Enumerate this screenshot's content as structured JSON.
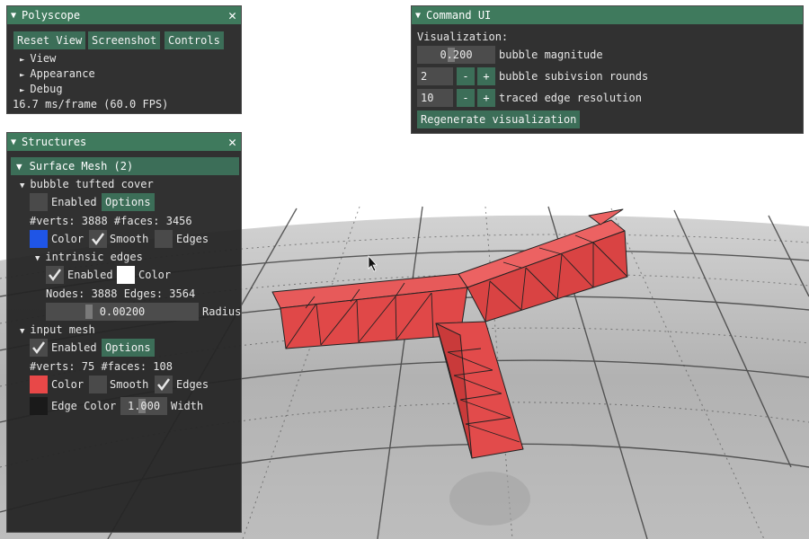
{
  "polyscope": {
    "title": "Polyscope",
    "buttons": [
      "Reset View",
      "Screenshot",
      "Controls"
    ],
    "tree": [
      "View",
      "Appearance",
      "Debug"
    ],
    "status": "16.7 ms/frame (60.0 FPS)"
  },
  "structures": {
    "title": "Structures",
    "header": "Surface Mesh (2)",
    "bubble": {
      "label": "bubble tufted cover",
      "enabled": "Enabled",
      "options": "Options",
      "stats": "#verts: 3888  #faces: 3456",
      "color_label": "Color",
      "smooth_label": "Smooth",
      "edges_label": "Edges",
      "color": "#1f55e6",
      "intrinsic": {
        "label": "intrinsic edges",
        "enabled": "Enabled",
        "color_label": "Color",
        "color": "#ffffff",
        "stats": "Nodes: 3888  Edges: 3564",
        "radius_value": "0.00200",
        "radius_label": "Radius"
      }
    },
    "input": {
      "label": "input mesh",
      "enabled": "Enabled",
      "options": "Options",
      "stats": "#verts: 75  #faces: 108",
      "color_label": "Color",
      "smooth_label": "Smooth",
      "edges_label": "Edges",
      "color": "#e84848",
      "edge_color_label": "Edge Color",
      "edge_color": "#1a1a1a",
      "width_value": "1.000",
      "width_label": "Width"
    }
  },
  "command": {
    "title": "Command UI",
    "section": "Visualization:",
    "magnitude_value": "0.200",
    "magnitude_label": "bubble magnitude",
    "rounds_value": "2",
    "rounds_label": "bubble subivsion rounds",
    "resolution_value": "10",
    "resolution_label": "traced edge resolution",
    "minus": "-",
    "plus": "+",
    "regen": "Regenerate visualization"
  }
}
